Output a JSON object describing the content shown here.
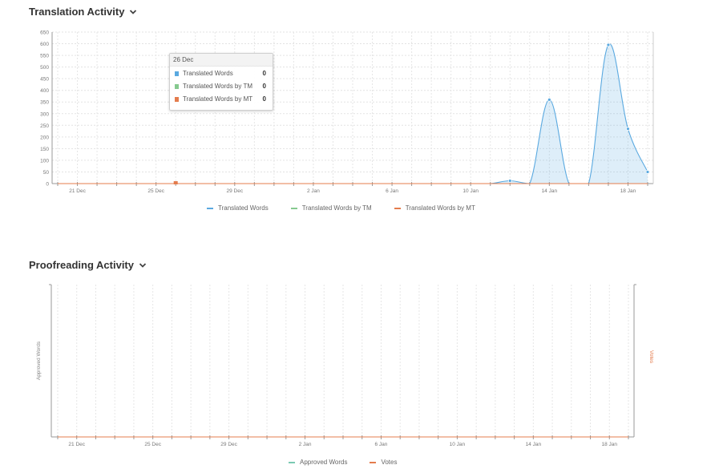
{
  "translation": {
    "title": "Translation Activity",
    "y_ticks": [
      "0",
      "50",
      "100",
      "150",
      "200",
      "250",
      "300",
      "350",
      "400",
      "450",
      "500",
      "550",
      "600",
      "650"
    ],
    "x_ticks": [
      "21 Dec",
      "25 Dec",
      "29 Dec",
      "2 Jan",
      "6 Jan",
      "10 Jan",
      "14 Jan",
      "18 Jan"
    ],
    "legend": [
      "Translated Words",
      "Translated Words by TM",
      "Translated Words by MT"
    ],
    "tooltip": {
      "date": "26 Dec",
      "rows": [
        {
          "label": "Translated Words",
          "value": "0"
        },
        {
          "label": "Translated Words by TM",
          "value": "0"
        },
        {
          "label": "Translated Words by MT",
          "value": "0"
        }
      ]
    }
  },
  "proofreading": {
    "title": "Proofreading Activity",
    "y_left_label": "Approved Words",
    "y_right_label": "Votes",
    "x_ticks": [
      "21 Dec",
      "25 Dec",
      "29 Dec",
      "2 Jan",
      "6 Jan",
      "10 Jan",
      "14 Jan",
      "18 Jan"
    ],
    "legend": [
      "Approved Words",
      "Votes"
    ]
  },
  "colors": {
    "translated": "#5aa9e0",
    "tm": "#86c98f",
    "mt": "#e47c4d",
    "approved": "#7bc9b2",
    "votes": "#e47c4d"
  },
  "chart_data": [
    {
      "type": "area",
      "title": "Translation Activity",
      "x": [
        "20 Dec",
        "21 Dec",
        "22 Dec",
        "23 Dec",
        "24 Dec",
        "25 Dec",
        "26 Dec",
        "27 Dec",
        "28 Dec",
        "29 Dec",
        "30 Dec",
        "31 Dec",
        "1 Jan",
        "2 Jan",
        "3 Jan",
        "4 Jan",
        "5 Jan",
        "6 Jan",
        "7 Jan",
        "8 Jan",
        "9 Jan",
        "10 Jan",
        "11 Jan",
        "12 Jan",
        "13 Jan",
        "14 Jan",
        "15 Jan",
        "16 Jan",
        "17 Jan",
        "18 Jan",
        "19 Jan"
      ],
      "ylim": [
        0,
        650
      ],
      "series": [
        {
          "name": "Translated Words",
          "values": [
            0,
            0,
            0,
            0,
            0,
            0,
            0,
            0,
            0,
            0,
            0,
            0,
            0,
            0,
            0,
            0,
            0,
            0,
            0,
            0,
            0,
            0,
            0,
            12,
            0,
            360,
            0,
            0,
            595,
            235,
            50
          ]
        },
        {
          "name": "Translated Words by TM",
          "values": [
            0,
            0,
            0,
            0,
            0,
            0,
            0,
            0,
            0,
            0,
            0,
            0,
            0,
            0,
            0,
            0,
            0,
            0,
            0,
            0,
            0,
            0,
            0,
            0,
            0,
            0,
            0,
            0,
            0,
            0,
            0
          ]
        },
        {
          "name": "Translated Words by MT",
          "values": [
            0,
            0,
            0,
            0,
            0,
            0,
            0,
            0,
            0,
            0,
            0,
            0,
            0,
            0,
            0,
            0,
            0,
            0,
            0,
            0,
            0,
            0,
            0,
            0,
            0,
            0,
            0,
            0,
            0,
            0,
            0
          ]
        }
      ]
    },
    {
      "type": "line",
      "title": "Proofreading Activity",
      "x": [
        "20 Dec",
        "21 Dec",
        "22 Dec",
        "23 Dec",
        "24 Dec",
        "25 Dec",
        "26 Dec",
        "27 Dec",
        "28 Dec",
        "29 Dec",
        "30 Dec",
        "31 Dec",
        "1 Jan",
        "2 Jan",
        "3 Jan",
        "4 Jan",
        "5 Jan",
        "6 Jan",
        "7 Jan",
        "8 Jan",
        "9 Jan",
        "10 Jan",
        "11 Jan",
        "12 Jan",
        "13 Jan",
        "14 Jan",
        "15 Jan",
        "16 Jan",
        "17 Jan",
        "18 Jan",
        "19 Jan"
      ],
      "series": [
        {
          "name": "Approved Words",
          "values": [
            0,
            0,
            0,
            0,
            0,
            0,
            0,
            0,
            0,
            0,
            0,
            0,
            0,
            0,
            0,
            0,
            0,
            0,
            0,
            0,
            0,
            0,
            0,
            0,
            0,
            0,
            0,
            0,
            0,
            0,
            0
          ]
        },
        {
          "name": "Votes",
          "values": [
            0,
            0,
            0,
            0,
            0,
            0,
            0,
            0,
            0,
            0,
            0,
            0,
            0,
            0,
            0,
            0,
            0,
            0,
            0,
            0,
            0,
            0,
            0,
            0,
            0,
            0,
            0,
            0,
            0,
            0,
            0
          ]
        }
      ]
    }
  ]
}
